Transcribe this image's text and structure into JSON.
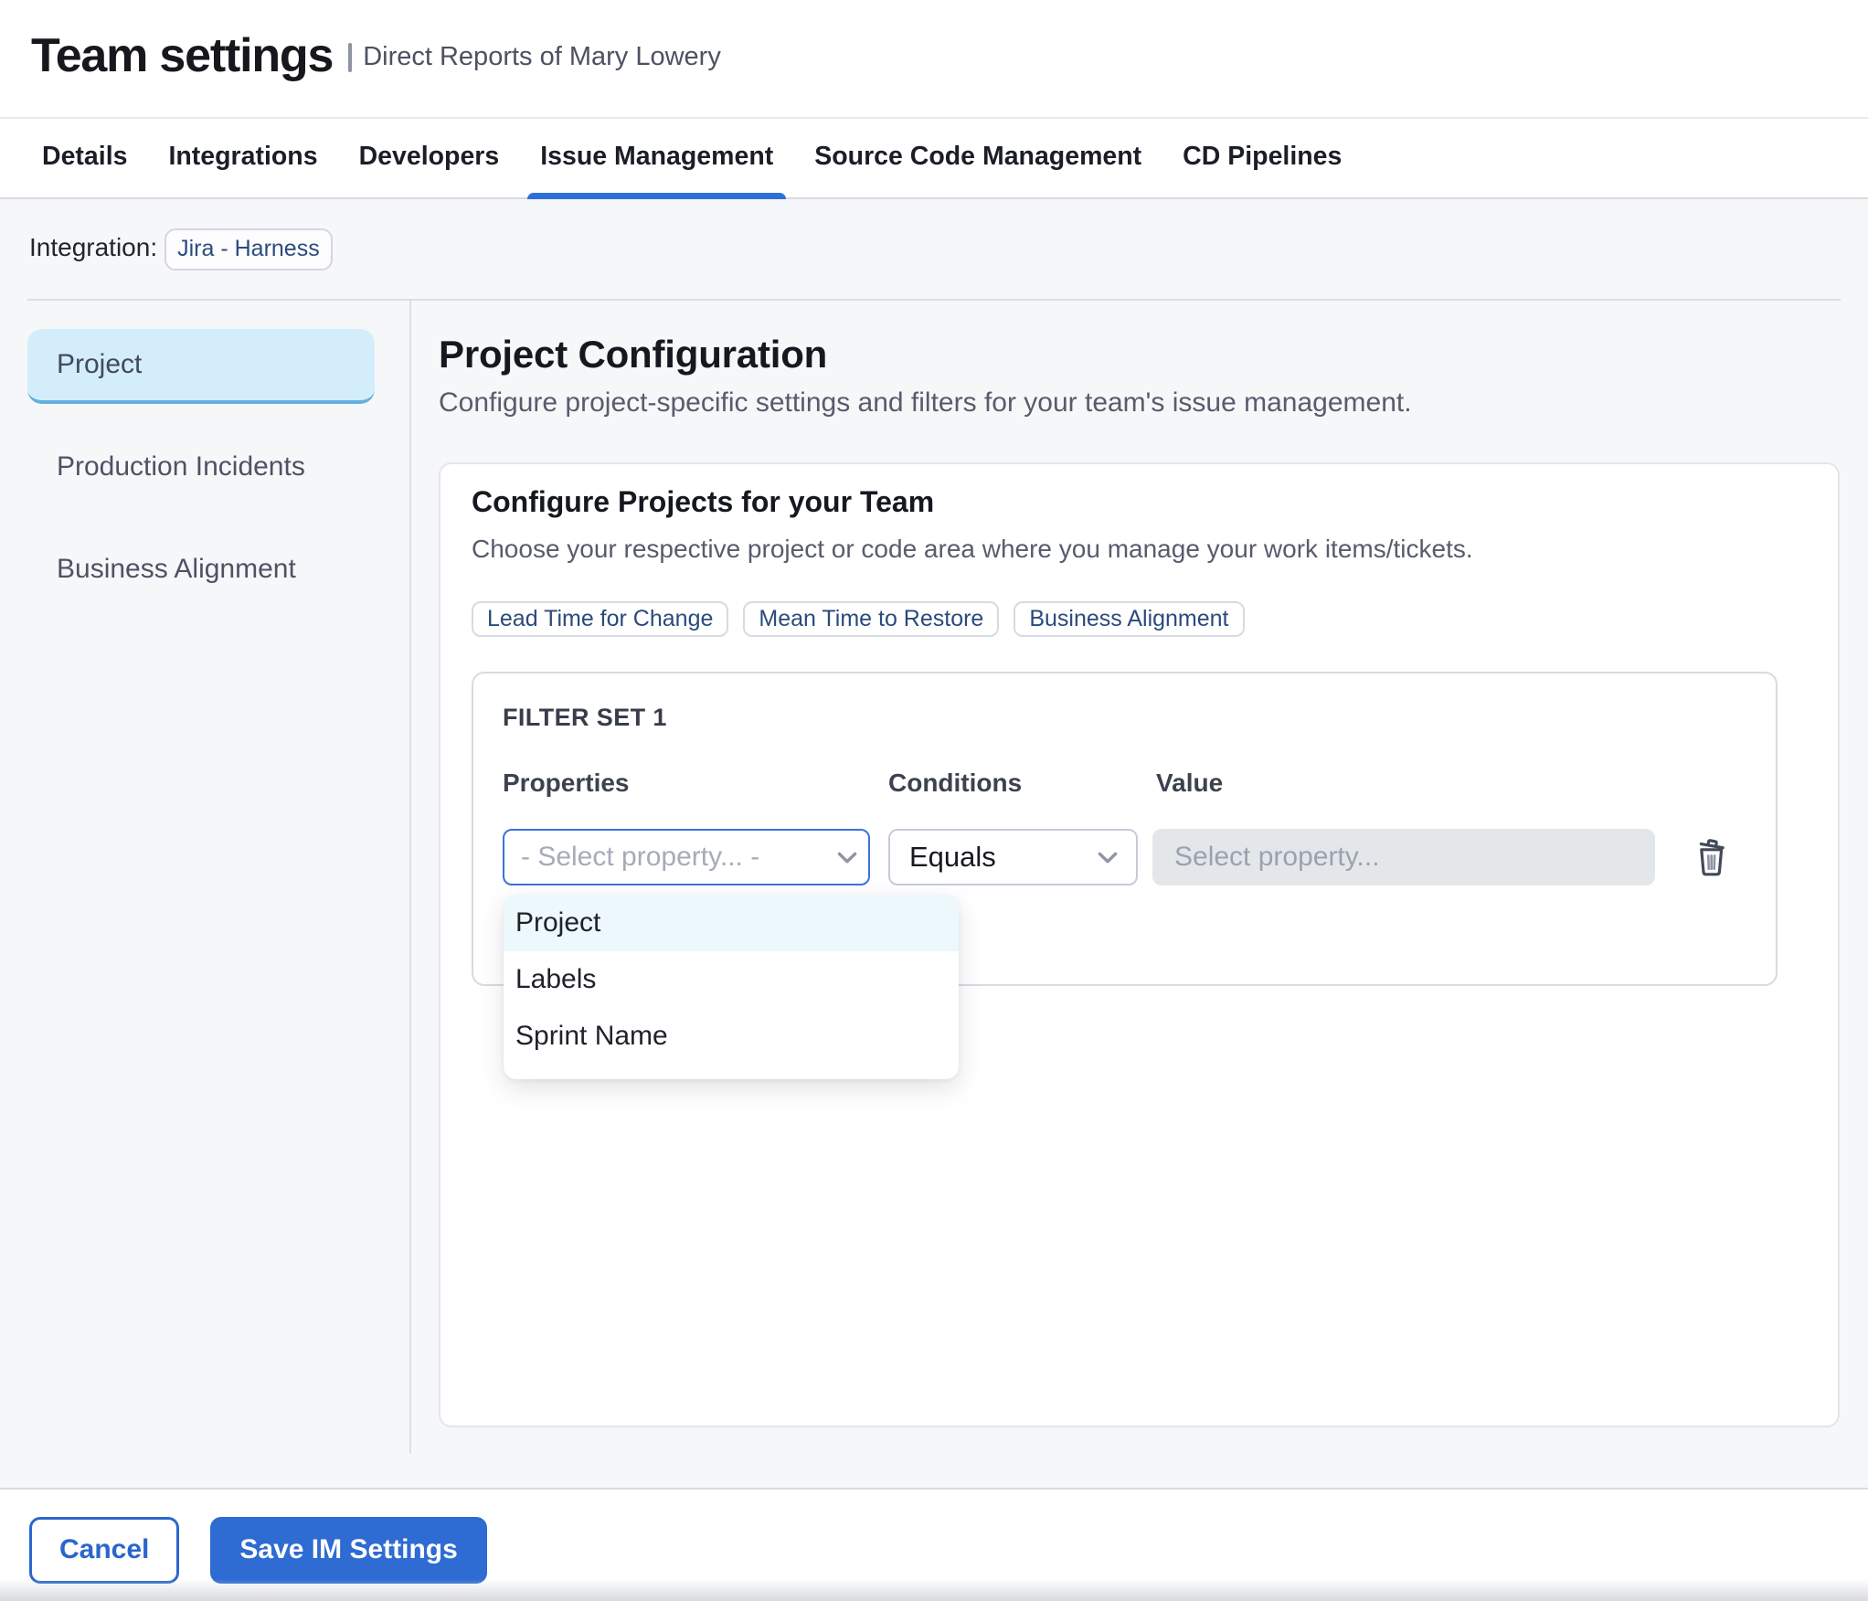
{
  "header": {
    "title": "Team settings",
    "subtitle": "Direct Reports of Mary Lowery"
  },
  "tabs": [
    {
      "label": "Details"
    },
    {
      "label": "Integrations"
    },
    {
      "label": "Developers"
    },
    {
      "label": "Issue Management",
      "active": true
    },
    {
      "label": "Source Code Management"
    },
    {
      "label": "CD Pipelines"
    }
  ],
  "integration": {
    "label": "Integration:",
    "chip": "Jira - Harness"
  },
  "sidebar": {
    "items": [
      {
        "label": "Project",
        "selected": true
      },
      {
        "label": "Production Incidents"
      },
      {
        "label": "Business Alignment"
      }
    ]
  },
  "main": {
    "title": "Project Configuration",
    "description": "Configure project-specific settings and filters for your team's issue management.",
    "card": {
      "title": "Configure Projects for your Team",
      "description": "Choose your respective project or code area where you manage your work items/tickets.",
      "chips": [
        {
          "label": "Lead Time for Change"
        },
        {
          "label": "Mean Time to Restore"
        },
        {
          "label": "Business Alignment"
        }
      ],
      "filter_set": {
        "title": "FILTER SET 1",
        "properties_label": "Properties",
        "conditions_label": "Conditions",
        "value_label": "Value",
        "property_placeholder": "- Select property... -",
        "condition_value": "Equals",
        "value_placeholder": "Select property...",
        "dropdown": {
          "items": [
            {
              "label": "Project",
              "highlighted": true
            },
            {
              "label": "Labels"
            },
            {
              "label": "Sprint Name"
            }
          ]
        }
      }
    }
  },
  "footer": {
    "cancel_label": "Cancel",
    "save_label": "Save IM Settings"
  },
  "colors": {
    "primary_blue": "#2e6bd2",
    "tab_underline": "#2e6fd6",
    "selected_item_bg": "#d3eefa",
    "selected_item_border": "#61b0dd",
    "section_bg": "#f6f7f9",
    "chip_text": "#2b4a7c",
    "dropdown_highlight": "#edf8fc"
  }
}
